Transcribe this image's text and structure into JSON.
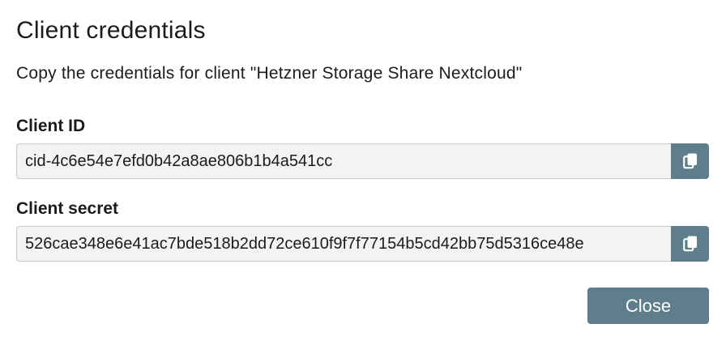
{
  "dialog": {
    "title": "Client credentials",
    "description": "Copy the credentials for client \"Hetzner Storage Share Nextcloud\""
  },
  "fields": {
    "client_id": {
      "label": "Client ID",
      "value": "cid-4c6e54e7efd0b42a8ae806b1b4a541cc",
      "copy_icon": "copy-icon"
    },
    "client_secret": {
      "label": "Client secret",
      "value": "526cae348e6e41ac7bde518b2dd72ce610f9f7f77154b5cd42bb75d5316ce48e",
      "copy_icon": "copy-icon"
    }
  },
  "actions": {
    "close_label": "Close"
  },
  "colors": {
    "accent": "#5e7e8c",
    "input_background": "#f3f3f3",
    "text": "#1b1b1b"
  }
}
